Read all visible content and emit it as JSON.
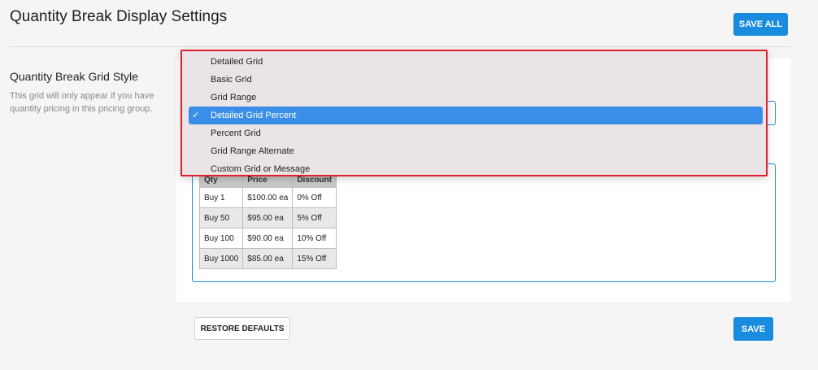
{
  "page": {
    "title": "Quantity Break Display Settings",
    "save_all_label": "SAVE ALL"
  },
  "section": {
    "label": "Quantity Break Grid Style",
    "description": "This grid will only appear if you have quantity pricing in this pricing group."
  },
  "dropdown": {
    "options": [
      "Detailed Grid",
      "Basic Grid",
      "Grid Range",
      "Detailed Grid Percent",
      "Percent Grid",
      "Grid Range Alternate",
      "Custom Grid or Message"
    ],
    "selected_index": 3,
    "check_glyph": "✓"
  },
  "preview": {
    "headers": [
      "Qty",
      "Price",
      "Discount"
    ],
    "rows": [
      [
        "Buy 1",
        "$100.00 ea",
        "0% Off"
      ],
      [
        "Buy 50",
        "$95.00 ea",
        "5% Off"
      ],
      [
        "Buy 100",
        "$90.00 ea",
        "10% Off"
      ],
      [
        "Buy 1000",
        "$85.00 ea",
        "15% Off"
      ]
    ]
  },
  "footer": {
    "restore_label": "RESTORE DEFAULTS",
    "save_label": "SAVE"
  },
  "colors": {
    "accent": "#1a8ce0",
    "highlight": "#e0212a",
    "selected": "#3b8ee8"
  }
}
